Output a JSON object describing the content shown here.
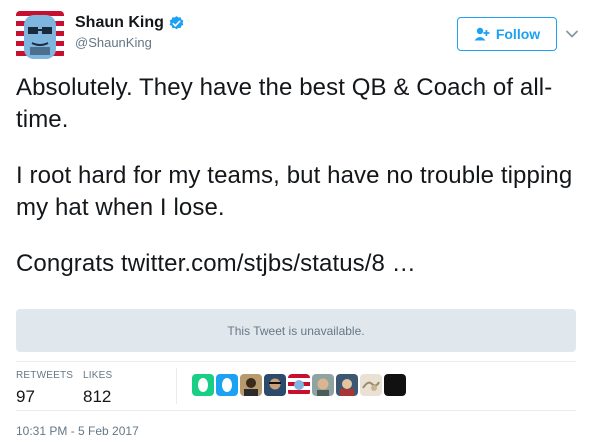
{
  "user": {
    "display_name": "Shaun King",
    "handle": "@ShaunKing",
    "verified": true
  },
  "follow_button": {
    "label": "Follow",
    "icon": "add-user-icon"
  },
  "menu_caret": {
    "icon": "chevron-down-icon"
  },
  "tweet": {
    "line1": "Absolutely. They have the best QB & Coach of all-time.",
    "line2": "I root hard for my teams, but have no trouble tipping my hat when I lose.",
    "line3_prefix": "Congrats",
    "link_text": "twitter.com/stjbs/status/8 …"
  },
  "quoted_tweet": {
    "text": "This Tweet is unavailable."
  },
  "stats": {
    "retweets_label": "RETWEETS",
    "retweets_value": "97",
    "likes_label": "LIKES",
    "likes_value": "812"
  },
  "timestamp": "10:31 PM - 5 Feb 2017",
  "colors": {
    "accent": "#1da1f2",
    "secondary_text": "#657786",
    "primary_text": "#14171a",
    "unavailable_bg": "#e1e8ed"
  }
}
